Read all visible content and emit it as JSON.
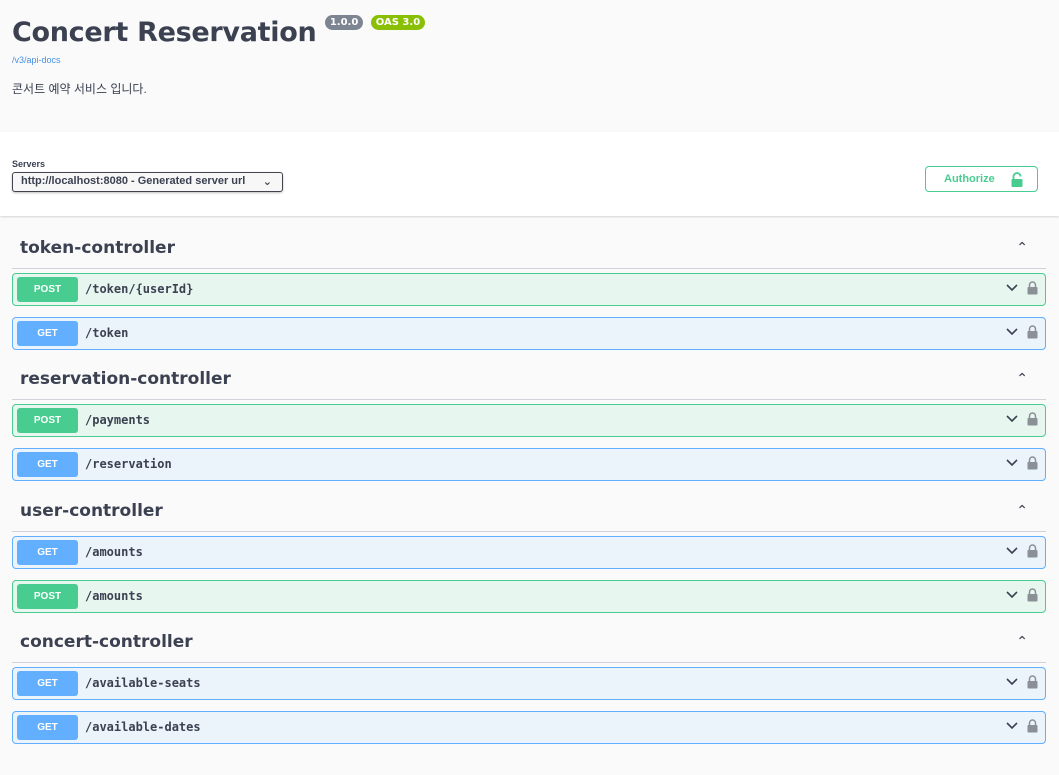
{
  "info": {
    "title": "Concert Reservation",
    "version": "1.0.0",
    "oas": "OAS 3.0",
    "api_docs_link": "/v3/api-docs",
    "description": "콘서트 예약 서비스 입니다."
  },
  "servers": {
    "label": "Servers",
    "selected": "http://localhost:8080 - Generated server url"
  },
  "authorize": {
    "label": "Authorize"
  },
  "colors": {
    "post": "#49cc90",
    "get": "#61affe"
  },
  "sections": [
    {
      "title": "token-controller",
      "ops": [
        {
          "method": "POST",
          "path": "/token/{userId}"
        },
        {
          "method": "GET",
          "path": "/token"
        }
      ]
    },
    {
      "title": "reservation-controller",
      "ops": [
        {
          "method": "POST",
          "path": "/payments"
        },
        {
          "method": "GET",
          "path": "/reservation"
        }
      ]
    },
    {
      "title": "user-controller",
      "ops": [
        {
          "method": "GET",
          "path": "/amounts"
        },
        {
          "method": "POST",
          "path": "/amounts"
        }
      ]
    },
    {
      "title": "concert-controller",
      "ops": [
        {
          "method": "GET",
          "path": "/available-seats"
        },
        {
          "method": "GET",
          "path": "/available-dates"
        }
      ]
    }
  ]
}
